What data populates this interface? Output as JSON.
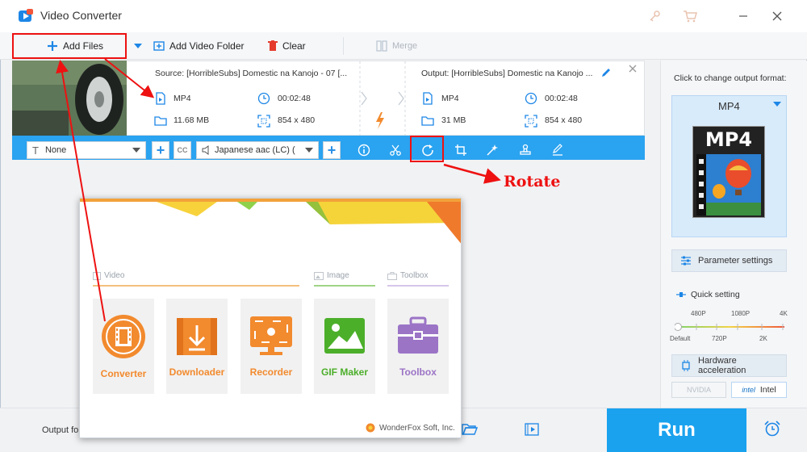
{
  "app": {
    "title": "Video Converter",
    "logo_icon": "video-converter-logo-icon"
  },
  "toolbar": {
    "add_files": "Add Files",
    "add_video_folder": "Add Video Folder",
    "clear": "Clear",
    "merge": "Merge"
  },
  "file": {
    "source": "Source: [HorribleSubs] Domestic na Kanojo - 07 [...",
    "output": "Output: [HorribleSubs] Domestic na Kanojo ...",
    "source_format": "MP4",
    "source_duration": "00:02:48",
    "source_size": "11.68 MB",
    "source_resolution": "854 x 480",
    "output_format": "MP4",
    "output_duration": "00:02:48",
    "output_size": "31 MB",
    "output_resolution": "854 x 480"
  },
  "filebar": {
    "subtitle": "None",
    "audio": "Japanese aac (LC) ("
  },
  "right_panel": {
    "hint": "Click to change output format:",
    "format": "MP4",
    "format_image_text": "MP4",
    "parameter_settings": "Parameter settings",
    "quick_setting": "Quick setting",
    "scale_top": [
      "480P",
      "1080P",
      "4K"
    ],
    "scale_bottom": [
      "Default",
      "720P",
      "2K"
    ],
    "hardware_acceleration": "Hardware acceleration",
    "nvidia": "NVIDIA",
    "intel_logo": "intel",
    "intel": "Intel"
  },
  "bottom": {
    "output_folder": "Output fold",
    "run": "Run"
  },
  "popup": {
    "section_video": "Video",
    "section_image": "Image",
    "section_toolbox": "Toolbox",
    "tiles": [
      {
        "label": "Converter",
        "color": "#f28a2e"
      },
      {
        "label": "Downloader",
        "color": "#f28a2e"
      },
      {
        "label": "Recorder",
        "color": "#f28a2e"
      },
      {
        "label": "GIF Maker",
        "color": "#4caf2a"
      },
      {
        "label": "Toolbox",
        "color": "#9b74c6"
      }
    ],
    "brand": "WonderFox Soft, Inc."
  },
  "annotation": {
    "rotate": "Rotate",
    "color": "#e11111"
  }
}
